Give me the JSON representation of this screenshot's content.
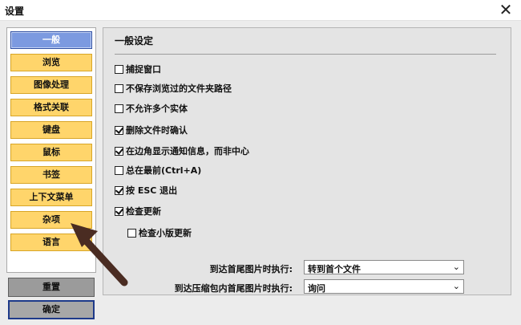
{
  "window": {
    "title": "设置",
    "close_glyph": "✕"
  },
  "sidebar": {
    "items": [
      {
        "label": "一般",
        "active": true
      },
      {
        "label": "浏览"
      },
      {
        "label": "图像处理"
      },
      {
        "label": "格式关联"
      },
      {
        "label": "键盘"
      },
      {
        "label": "鼠标"
      },
      {
        "label": "书签"
      },
      {
        "label": "上下文菜单"
      },
      {
        "label": "杂项"
      },
      {
        "label": "语言"
      }
    ],
    "reset_label": "重置",
    "ok_label": "确定"
  },
  "panel": {
    "title": "一般设定",
    "options": [
      {
        "label": "捕捉窗口",
        "checked": false
      },
      {
        "label": "不保存浏览过的文件夹路径",
        "checked": false
      },
      {
        "label": "不允许多个实体",
        "checked": false
      },
      {
        "label": "删除文件时确认",
        "checked": true
      },
      {
        "label": "在边角显示通知信息，而非中心",
        "checked": true
      },
      {
        "label": "总在最前(Ctrl+A)",
        "checked": false
      },
      {
        "label": "按 ESC 退出",
        "checked": true
      },
      {
        "label": "检查更新",
        "checked": true
      },
      {
        "label": "检查小版更新",
        "checked": false
      }
    ],
    "dropdowns": [
      {
        "label": "到达首尾图片时执行:",
        "value": "转到首个文件"
      },
      {
        "label": "到达压缩包内首尾图片时执行:",
        "value": "询问"
      }
    ]
  },
  "colors": {
    "nav_item": "#ffd56b",
    "nav_active": "#7c9ae0",
    "annotation_arrow": "#4a2c22"
  }
}
